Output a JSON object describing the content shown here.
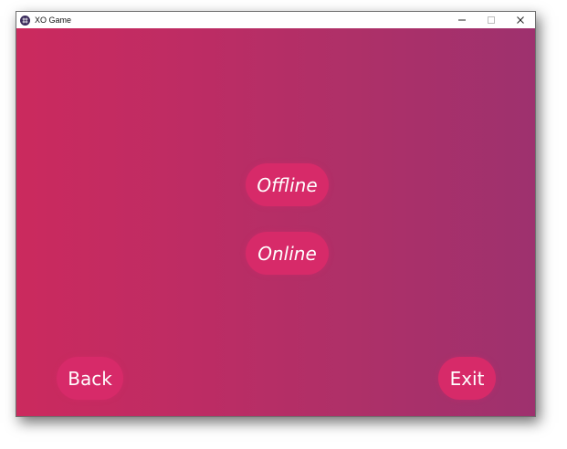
{
  "window": {
    "title": "XO Game",
    "controls": {
      "minimize_icon": "minimize-icon",
      "maximize_icon": "maximize-icon",
      "close_icon": "close-icon"
    }
  },
  "colors": {
    "gradient_start": "#cb2a5e",
    "gradient_end": "#9e316e",
    "button": "#d72a69",
    "text": "#ffffff"
  },
  "menu": {
    "offline_label": "Offline",
    "online_label": "Online"
  },
  "footer": {
    "back_label": "Back",
    "exit_label": "Exit"
  }
}
